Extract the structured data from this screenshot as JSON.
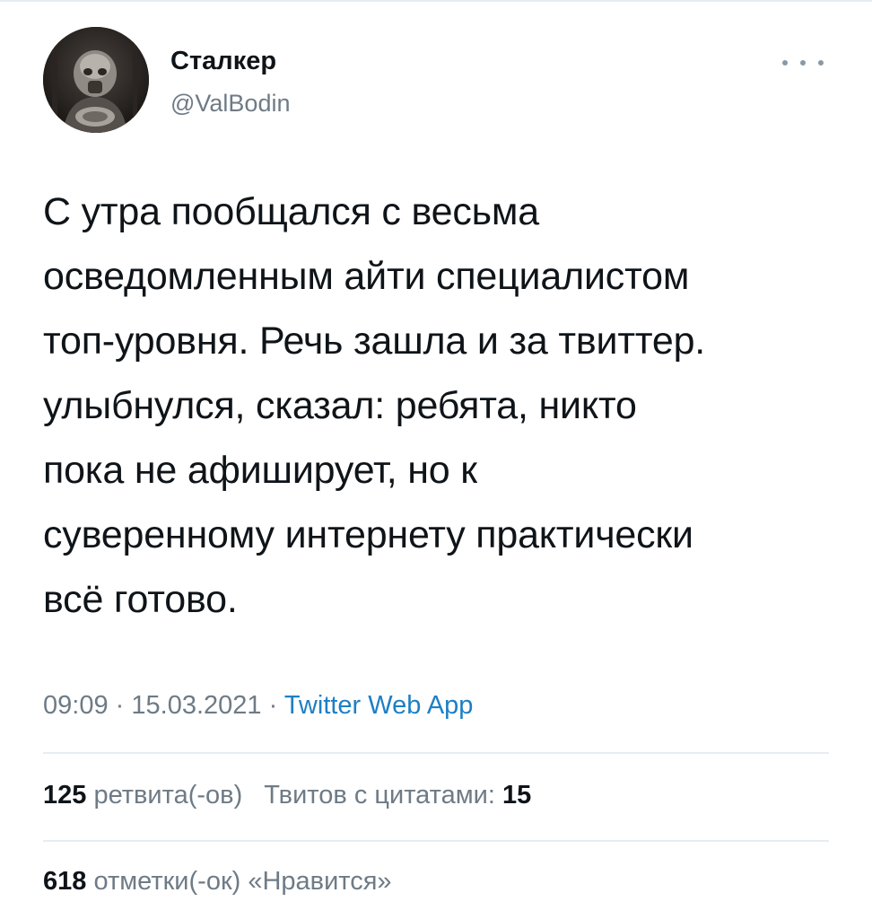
{
  "author": {
    "display_name": "Сталкер",
    "handle": "@ValBodin",
    "avatar_icon": "user-avatar-photo"
  },
  "more_icon": "more-options-icon",
  "tweet": {
    "text": "С утра пообщался с весьма\nосведомленным айти специалистом\nтоп-уровня. Речь зашла и за твиттер.\nулыбнулся, сказал: ребята, никто\nпока не афиширует, но к\nсуверенному интернету практически\nвсё готово."
  },
  "meta": {
    "time": "09:09",
    "separator": "·",
    "date": "15.03.2021",
    "source": "Twitter Web App"
  },
  "stats": {
    "retweets_count": "125",
    "retweets_label": "ретвита(-ов)",
    "quotes_label": "Твитов с цитатами:",
    "quotes_count": "15",
    "likes_count": "618",
    "likes_label": "отметки(-ок) «Нравится»"
  },
  "colors": {
    "text": "#0f1419",
    "secondary": "#6e7b86",
    "link": "#1d7fc4",
    "divider": "#e6ecf0"
  }
}
